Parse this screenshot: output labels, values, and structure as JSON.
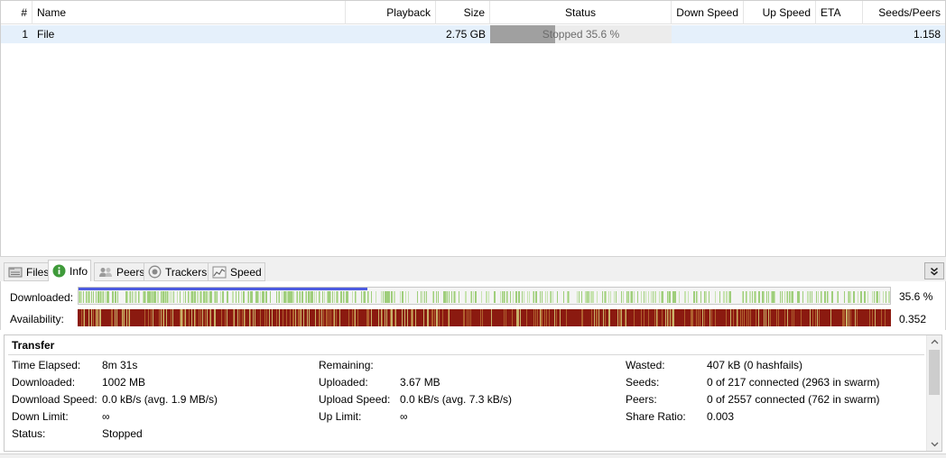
{
  "list": {
    "columns": {
      "num": "#",
      "name": "Name",
      "playback": "Playback",
      "size": "Size",
      "status": "Status",
      "down_speed": "Down Speed",
      "up_speed": "Up Speed",
      "eta": "ETA",
      "seeds_peers": "Seeds/Peers"
    },
    "rows": [
      {
        "num": "1",
        "name": "File",
        "playback": "",
        "size": "2.75 GB",
        "status": "Stopped 35.6 %",
        "progress": 0.356,
        "down_speed": "",
        "up_speed": "",
        "eta": "",
        "seeds_peers": "1.158"
      }
    ]
  },
  "tabs": [
    {
      "label": "Files",
      "icon": "files-icon"
    },
    {
      "label": "Info",
      "icon": "info-icon",
      "active": true
    },
    {
      "label": "Peers",
      "icon": "peers-icon"
    },
    {
      "label": "Trackers",
      "icon": "trackers-icon"
    },
    {
      "label": "Speed",
      "icon": "speed-icon"
    }
  ],
  "bars": {
    "downloaded_label": "Downloaded:",
    "downloaded_value": "35.6 %",
    "downloaded_fraction": 0.356,
    "availability_label": "Availability:",
    "availability_value": "0.352"
  },
  "transfer": {
    "title": "Transfer",
    "col1": [
      {
        "label": "Time Elapsed:",
        "value": "8m 31s"
      },
      {
        "label": "Downloaded:",
        "value": "1002 MB"
      },
      {
        "label": "Download Speed:",
        "value": "0.0 kB/s (avg. 1.9 MB/s)"
      },
      {
        "label": "Down Limit:",
        "value": "∞"
      },
      {
        "label": "Status:",
        "value": "Stopped"
      }
    ],
    "col2": [
      {
        "label": "Remaining:",
        "value": ""
      },
      {
        "label": "Uploaded:",
        "value": "3.67 MB"
      },
      {
        "label": "Upload Speed:",
        "value": "0.0 kB/s (avg. 7.3 kB/s)"
      },
      {
        "label": "Up Limit:",
        "value": "∞"
      }
    ],
    "col3": [
      {
        "label": "Wasted:",
        "value": "407 kB (0 hashfails)"
      },
      {
        "label": "Seeds:",
        "value": "0 of 217 connected (2963 in swarm)"
      },
      {
        "label": "Peers:",
        "value": "0 of 2557 connected (762 in swarm)"
      },
      {
        "label": "Share Ratio:",
        "value": "0.003"
      }
    ]
  },
  "colors": {
    "selection": "#e5f0fb",
    "progress_fill": "#a0a0a0",
    "downloaded_blue": "#4d5be0",
    "piece_green": "#9fce7c",
    "availability_dark": "#8b1a10",
    "availability_light": "#c9b26a"
  }
}
